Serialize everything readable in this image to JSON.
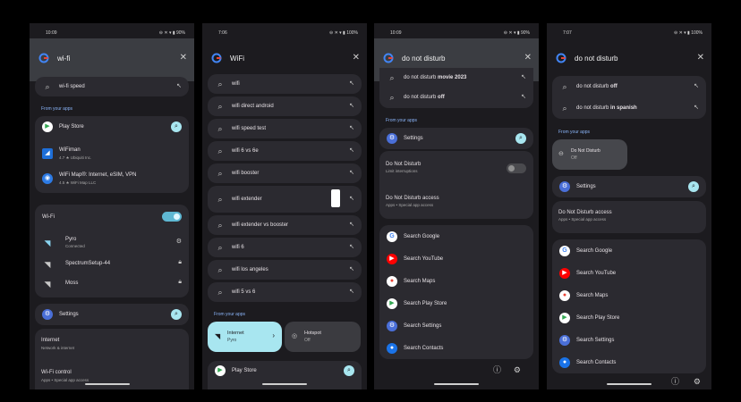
{
  "colors": {
    "accent": "#5fb8d3",
    "surface": "#2b2a30",
    "background": "#1c1b1f",
    "section": "#8ab4f8"
  },
  "panel1": {
    "time": "10:09",
    "status_icons": "⊖ ✕ ▾ ▮ 90%",
    "query": "wi-fi",
    "suggestion": "wi-fi speed",
    "from_apps": "From your apps",
    "apps": [
      {
        "name": "Play Store",
        "sub": ""
      },
      {
        "name": "WiFiman",
        "sub": "4.7 ★ Ubiquiti Inc."
      },
      {
        "name": "WiFi Map®: Internet, eSIM, VPN",
        "sub": "4.5 ★ WiFi Map LLC"
      }
    ],
    "wifi_title": "Wi-Fi",
    "networks": [
      {
        "name": "Pyro",
        "sub": "Connected"
      },
      {
        "name": "SpectrumSetup-44",
        "sub": ""
      },
      {
        "name": "Moss",
        "sub": ""
      }
    ],
    "settings": "Settings",
    "settings_items": [
      {
        "title": "Internet",
        "sub": "Network & internet"
      },
      {
        "title": "Wi-Fi control",
        "sub": "Apps • Special app access"
      }
    ]
  },
  "panel2": {
    "time": "7:06",
    "status_icons": "⊖ ✕ ▾ ▮ 100%",
    "query": "WiFi",
    "suggestions": [
      "wifi",
      "wifi direct android",
      "wifi speed test",
      "wifi 6 vs 6e",
      "wifi booster",
      "wifi extender",
      "wifi extender vs booster",
      "wifi 6",
      "wifi los angeles",
      "wifi 5 vs 6"
    ],
    "from_apps": "From your apps",
    "internet_tile": {
      "title": "Internet",
      "sub": "Pyro"
    },
    "hotspot_tile": {
      "title": "Hotspot",
      "sub": "Off"
    },
    "play_store": "Play Store"
  },
  "panel3": {
    "time": "10:09",
    "status_icons": "⊖ ✕ ▾ ▮ 90%",
    "query": "do not disturb",
    "suggestions": [
      {
        "pre": "do not disturb ",
        "bold": "movie 2023"
      },
      {
        "pre": "do not disturb ",
        "bold": "off"
      }
    ],
    "from_apps": "From your apps",
    "settings": "Settings",
    "dnd_title": "Do Not Disturb",
    "dnd_sub": "Limit interruptions",
    "access_title": "Do Not Disturb access",
    "access_sub": "Apps • Special app access",
    "searches": [
      "Search Google",
      "Search YouTube",
      "Search Maps",
      "Search Play Store",
      "Search Settings",
      "Search Contacts"
    ]
  },
  "panel4": {
    "time": "7:07",
    "status_icons": "⊖ ✕ ▾ ▮ 100%",
    "query": "do not disturb",
    "suggestions": [
      {
        "pre": "do not disturb ",
        "bold": "off"
      },
      {
        "pre": "do not disturb ",
        "bold": "in spanish"
      }
    ],
    "from_apps": "From your apps",
    "dnd_tile": {
      "title": "Do Not Disturb",
      "sub": "Off"
    },
    "settings": "Settings",
    "access_title": "Do Not Disturb access",
    "access_sub": "Apps • Special app access",
    "searches": [
      "Search Google",
      "Search YouTube",
      "Search Maps",
      "Search Play Store",
      "Search Settings",
      "Search Contacts"
    ]
  }
}
